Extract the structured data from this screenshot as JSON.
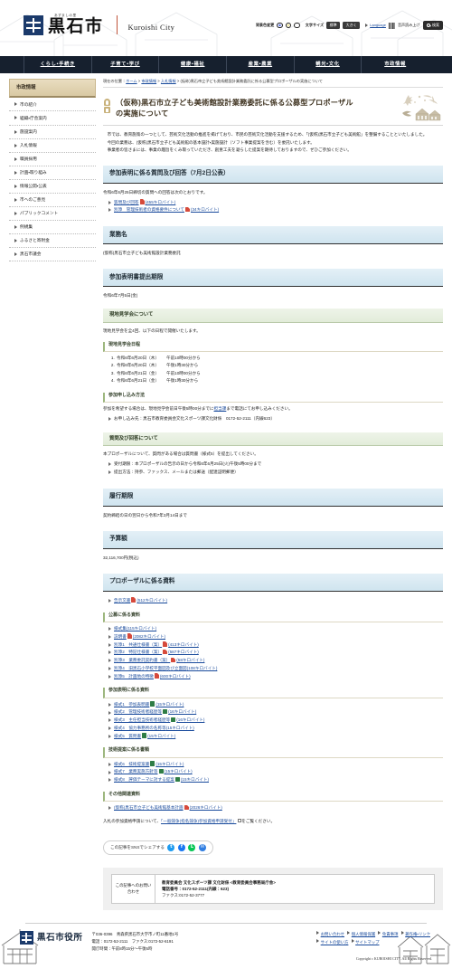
{
  "header": {
    "logo_ruby": "あずましの里",
    "logo_main": "黒石市",
    "logo_en": "Kuroishi City",
    "bgcolor_label": "背景色変更",
    "fontsize_label": "文字サイズ",
    "size_standard": "標準",
    "size_large": "大きく",
    "language": "Language",
    "voice": "音声読み上げ",
    "search": "検索"
  },
  "gnav": [
    {
      "label": "くらし・手続き"
    },
    {
      "label": "子育て・学び"
    },
    {
      "label": "健康・福祉"
    },
    {
      "label": "産業・農業"
    },
    {
      "label": "観光・文化"
    },
    {
      "label": "市政情報"
    }
  ],
  "sidebar": {
    "title": "市政情報",
    "items": [
      {
        "label": "市の紹介"
      },
      {
        "label": "組織・庁舎案内"
      },
      {
        "label": "施設案内"
      },
      {
        "label": "入札情報"
      },
      {
        "label": "職員採用"
      },
      {
        "label": "計画・取り組み"
      },
      {
        "label": "情報公開・公表"
      },
      {
        "label": "市へのご意見"
      },
      {
        "label": "パブリックコメント"
      },
      {
        "label": "例規集"
      },
      {
        "label": "ふるさと寄附金"
      },
      {
        "label": "黒石市議会"
      }
    ]
  },
  "breadcrumb": {
    "prefix": "現在の位置：",
    "home": "ホーム",
    "sep": " > ",
    "level2": "市政情報",
    "level3": "入札情報",
    "current": "(仮称)黒石市立子ども美術館設計業務委託に係る公募型プロポーザルの実施について"
  },
  "page": {
    "title": "（仮称)黒石市立子ども美術館設計業務委託に係る公募型プロポーザルの実施について",
    "intro_p1": "市では、教育施策の一つとして、芸術文化活動の推進を掲げており、市民の芸術文化活動を支援するため、「(仮称)黒石市立子ども美術館」を整備することといたしました。",
    "intro_p2": "今回の業務は、(仮称)黒石市立子ども美術館の基本設計・実施設計（ソフト事業提案を含む）を委託いたします。",
    "intro_p3": "事業者の皆さまには、事業の趣旨をくみ取っていただき、創意工夫を凝らした提案を期待しておりますので、ぜひご参加ください。"
  },
  "sections": {
    "qa_public": {
      "heading": "参加表明に係る質問及び回答（7月2日公表）",
      "lead": "令和6年6月25日締切の質問への回答は次のとおりです。",
      "links": [
        {
          "label": "質問及び回答",
          "icon": "pdf-icon",
          "size": "(455キロバイト)"
        },
        {
          "label": "別添　管理技術者の資格要件について",
          "icon": "pdf-icon",
          "size": "(34キロバイト)"
        }
      ]
    },
    "business_name": {
      "heading": "業務名",
      "text": "(仮称)黒石市立子ども美術館設計業務委託"
    },
    "deadline": {
      "heading": "参加表明書提出期限",
      "text": "令和6年7月5日(金)"
    },
    "site_tour": {
      "heading": "現地見学会について",
      "lead": "現地見学会を全4回、以下の日程で開催いたします。",
      "sub_schedule": "現地見学会日程",
      "dates": [
        {
          "date": "令和6年6月20日（木）",
          "time": "午前10時00分から"
        },
        {
          "date": "令和6年6月20日（木）",
          "time": "午後1時30分から"
        },
        {
          "date": "令和6年6月21日（金）",
          "time": "午前10時00分から"
        },
        {
          "date": "令和6年6月21日（金）",
          "time": "午後1時30分から"
        }
      ],
      "sub_apply": "参加申し込み方法",
      "apply_text_a": "参加を希望する場合は、現地見学会前日午後5時00分までに",
      "apply_link": "担当課",
      "apply_text_b": "まで電話にてお申し込みください。",
      "contact_item": "お申し込み先：黒石市教育委員会文化スポーツ課文化財係　0172-52-2111（内線623）"
    },
    "qa": {
      "heading": "質問及び回答について",
      "lead": "本プロポーザルについて、質問がある場合は質問書（様式5）を提出してください。",
      "items": [
        {
          "label": "受付期限：本プロポーザルの告示の日から令和6年6月25日(火)午後5時00分まで"
        },
        {
          "label": "提出方法：持参、ファックス、メールまたは郵送（配達証明郵便）"
        }
      ]
    },
    "term": {
      "heading": "履行期限",
      "text": "契約締結の日の翌日から令和7年3月14日まで"
    },
    "budget": {
      "heading": "予算額",
      "text": "32,116,700円(税込)"
    },
    "materials": {
      "heading": "プロポーザルに係る資料",
      "top_links": [
        {
          "label": "告示文書",
          "icon": "pdf-icon",
          "size": "(512キロバイト)"
        }
      ],
      "groups": [
        {
          "title": "公募に係る資料",
          "links": [
            {
              "label": "様式集",
              "icon": "none",
              "size": "(115キロバイト)"
            },
            {
              "label": "説明書",
              "icon": "pdf-icon",
              "size": "(2082キロバイト)"
            },
            {
              "label": "別添1　共通仕様書（案）",
              "icon": "pdf-icon",
              "size": "(413キロバイト)"
            },
            {
              "label": "別添2　特記仕様書（案）",
              "icon": "pdf-icon",
              "size": "(587キロバイト)"
            },
            {
              "label": "別添3　業務委託契約書（案）",
              "icon": "pdf-icon",
              "size": "(58キロバイト)"
            },
            {
              "label": "別添4　旧黒石小学校平面図及び立面図",
              "icon": "none",
              "size": "(108キロバイト)"
            },
            {
              "label": "別添5　計画地の特徴",
              "icon": "pdf-icon",
              "size": "(600キロバイト)"
            }
          ]
        },
        {
          "title": "参加表明に係る資料",
          "links": [
            {
              "label": "様式1　参加表明書",
              "icon": "xls-icon",
              "size": "(15キロバイト)"
            },
            {
              "label": "様式2　管理技術者経歴等",
              "icon": "xls-icon",
              "size": "(16キロバイト)"
            },
            {
              "label": "様式3　主任担当技術者経歴等",
              "icon": "xls-icon",
              "size": "(16キロバイト)"
            },
            {
              "label": "様式4　協力事務所の名称等",
              "icon": "none",
              "size": "(15キロバイト)"
            },
            {
              "label": "様式5　質問書",
              "icon": "xls-icon",
              "size": "(15キロバイト)"
            }
          ]
        },
        {
          "title": "技術提案に係る書類",
          "links": [
            {
              "label": "様式6　技術提案書",
              "icon": "xls-icon",
              "size": "(15キロバイト)"
            },
            {
              "label": "様式7　業務実施方針等",
              "icon": "xls-icon",
              "size": "(15キロバイト)"
            },
            {
              "label": "様式8　評価テーマに対する提案",
              "icon": "xls-icon",
              "size": "(15キロバイト)"
            }
          ]
        },
        {
          "title": "その他関連資料",
          "links": [
            {
              "label": "(仮称)黒石市立子ども美術館基本計画",
              "icon": "pdf-icon",
              "size": "(2026キロバイト)"
            }
          ]
        }
      ],
      "note_a": "入札の参加資格申請について、",
      "note_link": "「一般競争(指名競争)参加資格申請受付」",
      "note_b": "をご覧ください。"
    }
  },
  "sns": {
    "label": "この記事をSNSでシェアする",
    "buttons": [
      {
        "name": "twitter-share-button",
        "glyph": "t",
        "color": "#1d9bf0"
      },
      {
        "name": "facebook-share-button",
        "glyph": "f",
        "color": "#1877f2"
      },
      {
        "name": "line-share-button",
        "glyph": "L",
        "color": "#06c755"
      },
      {
        "name": "email-share-button",
        "glyph": "✉",
        "color": "#2f7de1"
      }
    ]
  },
  "contact": {
    "label": "この記事へのお問い合わせ",
    "dept": "教育委員会 文化スポーツ課 文化財係 <教育委員会事務局庁舎>",
    "tel": "電話番号：0172-52-2111(内線：623)",
    "fax": "ファクス:0172-52-3777"
  },
  "footer": {
    "office": "黒石市役所",
    "address": "〒036-0396　青森県黒石市大字市ノ町11番地1号",
    "tel": "電話：0172-52-2111　ファクス:0172-52-6191",
    "hours": "開庁時間：午前8時15分〜午後5時",
    "links": [
      {
        "label": "お問い合わせ"
      },
      {
        "label": "個人情報保護"
      },
      {
        "label": "免責事項"
      },
      {
        "label": "著作権・リンク"
      },
      {
        "label": "サイトの使い方"
      },
      {
        "label": "サイトマップ"
      }
    ],
    "copyright": "Copyright c KUROISHI CITY. All Rights Reserved."
  }
}
